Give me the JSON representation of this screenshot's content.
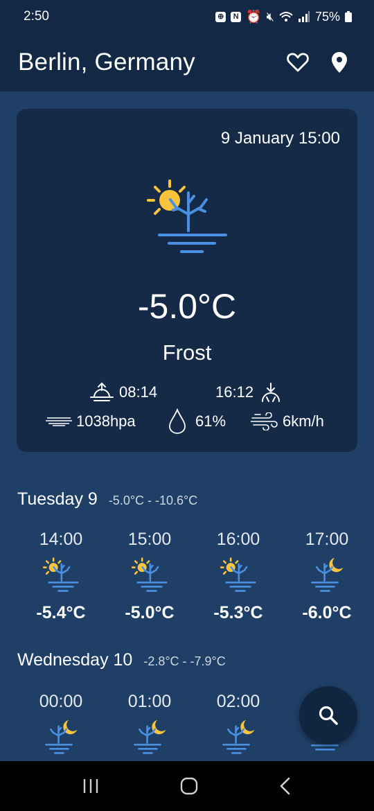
{
  "status": {
    "time": "2:50",
    "battery": "75%"
  },
  "header": {
    "title": "Berlin, Germany",
    "favorite_icon": "heart-outline-icon",
    "location_icon": "location-pin-icon"
  },
  "current": {
    "datetime": "9 January 15:00",
    "temperature": "-5.0°C",
    "condition": "Frost",
    "sunrise": "08:14",
    "sunset": "16:12",
    "pressure": "1038hpa",
    "humidity": "61%",
    "wind": "6km/h"
  },
  "days": [
    {
      "name": "Tuesday 9",
      "range": "-5.0°C - -10.6°C",
      "hours": [
        {
          "time": "14:00",
          "temp": "-5.4°C",
          "icon": "frost-sun-icon"
        },
        {
          "time": "15:00",
          "temp": "-5.0°C",
          "icon": "frost-sun-icon"
        },
        {
          "time": "16:00",
          "temp": "-5.3°C",
          "icon": "frost-sun-icon"
        },
        {
          "time": "17:00",
          "temp": "-6.0°C",
          "icon": "frost-moon-icon"
        }
      ]
    },
    {
      "name": "Wednesday 10",
      "range": "-2.8°C - -7.9°C",
      "hours": [
        {
          "time": "00:00",
          "icon": "frost-moon-icon"
        },
        {
          "time": "01:00",
          "icon": "frost-moon-icon"
        },
        {
          "time": "02:00",
          "icon": "frost-moon-icon"
        }
      ]
    }
  ],
  "colors": {
    "background": "#1f3f66",
    "bar": "#122844",
    "card": "#142a47",
    "sun": "#f9c33c",
    "frost": "#4a90e2"
  }
}
